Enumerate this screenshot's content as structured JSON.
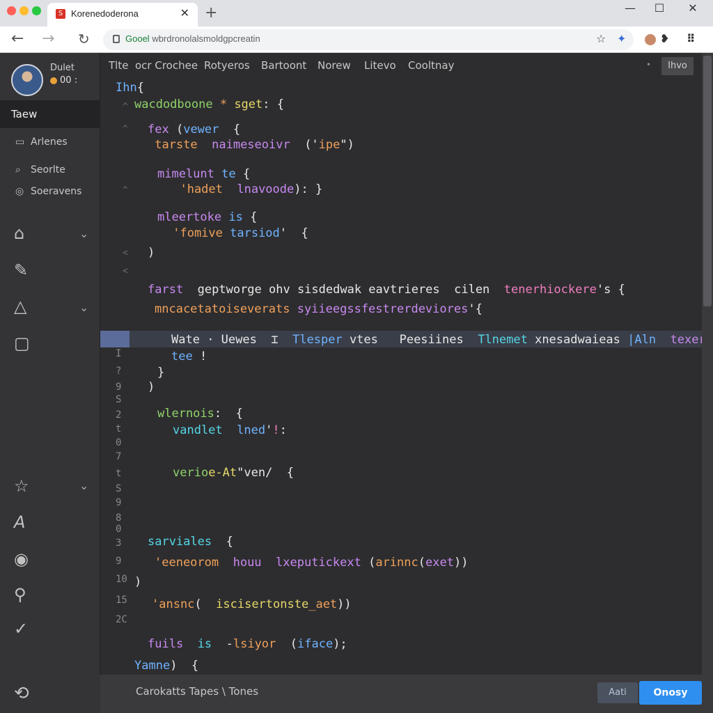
{
  "browser": {
    "tab_title": "Korenedoderona",
    "tab_close": "✕",
    "new_tab": "+",
    "url_scheme": "Gooel",
    "url_rest": " wbrdronolalsmoldgpcreatin",
    "window_controls": [
      "—",
      "☐",
      "✕"
    ]
  },
  "user": {
    "name": "Dulet",
    "status": "00",
    "status_suffix": ":"
  },
  "sidebar": {
    "active_label": "Taew",
    "items": [
      {
        "icon": "folder-icon",
        "glyph": "▭",
        "label": "Arlenes"
      },
      {
        "icon": "tag-icon",
        "glyph": "⌕",
        "label": "Seorlte"
      },
      {
        "icon": "settings-icon",
        "glyph": "◎",
        "label": "Soeravens"
      }
    ],
    "icons": [
      {
        "name": "home-icon",
        "glyph": "⌂",
        "chevron": true
      },
      {
        "name": "pen-icon",
        "glyph": "✎",
        "chevron": false
      },
      {
        "name": "triangle-icon",
        "glyph": "△",
        "chevron": true
      },
      {
        "name": "square-icon",
        "glyph": "▢",
        "chevron": false
      },
      {
        "name": "star-icon",
        "glyph": "☆",
        "chevron": true
      },
      {
        "name": "script-icon",
        "glyph": "A",
        "chevron": false
      },
      {
        "name": "record-icon",
        "glyph": "◉",
        "chevron": false
      },
      {
        "name": "search-icon",
        "glyph": "⚲",
        "chevron": false
      },
      {
        "name": "check-icon",
        "glyph": "✓",
        "chevron": false
      }
    ],
    "bottom_icon": "⟲"
  },
  "menubar": {
    "items": [
      "Tlte",
      "ocr Crochee",
      "Rotyeros",
      "Bartoont",
      "Norew",
      "Litevo",
      "Cooltnay"
    ],
    "dot": "•",
    "button": "Ihvo"
  },
  "code_lines": [
    [
      {
        "t": "Ihn",
        "c": "c-blue"
      },
      {
        "t": "{",
        "c": "c-white"
      }
    ],
    [
      {
        "t": "wacdodboone",
        "c": "c-green"
      },
      {
        "t": " * ",
        "c": "c-orange"
      },
      {
        "t": "sget",
        "c": "c-yellow"
      },
      {
        "t": ": {",
        "c": "c-white"
      }
    ],
    [
      {
        "t": "fex",
        "c": "c-purple"
      },
      {
        "t": " (",
        "c": "c-white"
      },
      {
        "t": "vewer",
        "c": "c-blue"
      },
      {
        "t": "  {",
        "c": "c-white"
      }
    ],
    [
      {
        "t": " tarste",
        "c": "c-orange"
      },
      {
        "t": "  naimeseoivr",
        "c": "c-purple"
      },
      {
        "t": "  ('",
        "c": "c-white"
      },
      {
        "t": "ipe",
        "c": "c-orange"
      },
      {
        "t": "\")",
        "c": "c-white"
      }
    ],
    [
      {
        "t": "mimelunt",
        "c": "c-purple"
      },
      {
        "t": " te",
        "c": "c-blue"
      },
      {
        "t": " {",
        "c": "c-white"
      }
    ],
    [
      {
        "t": "  'hadet",
        "c": "c-orange"
      },
      {
        "t": "  lnavoode",
        "c": "c-purple"
      },
      {
        "t": "): }",
        "c": "c-white"
      }
    ],
    [
      {
        "t": "mleertoke",
        "c": "c-purple"
      },
      {
        "t": " is",
        "c": "c-blue"
      },
      {
        "t": " {",
        "c": "c-white"
      }
    ],
    [
      {
        "t": " 'fomive",
        "c": "c-orange"
      },
      {
        "t": " tarsiod",
        "c": "c-blue"
      },
      {
        "t": "'  {",
        "c": "c-white"
      }
    ],
    [
      {
        "t": ")",
        "c": "c-white"
      }
    ],
    [
      {
        "t": "farst",
        "c": "c-purple"
      },
      {
        "t": "  geptworge ohv sisdedwak eavtrieres  cilen  ",
        "c": "c-white"
      },
      {
        "t": "tenerhiockere",
        "c": "c-pink"
      },
      {
        "t": "'s {",
        "c": "c-white"
      }
    ],
    [
      {
        "t": "mncacetatoiseverats",
        "c": "c-orange"
      },
      {
        "t": " syiieegssfestrerdeviores",
        "c": "c-purple"
      },
      {
        "t": "'{",
        "c": "c-white"
      }
    ],
    [
      {
        "t": "Wate",
        "c": "c-white"
      },
      {
        "t": " · ",
        "c": "c-white"
      },
      {
        "t": "Uewes",
        "c": "c-white"
      },
      {
        "t": "  ⌶  ",
        "c": "c-white"
      },
      {
        "t": "Tlesper",
        "c": "c-blue"
      },
      {
        "t": " vtes   ",
        "c": "c-white"
      },
      {
        "t": "Peesiines",
        "c": "c-white"
      },
      {
        "t": "  Tlnemet",
        "c": "c-cyan"
      },
      {
        "t": " xnesadwaieas",
        "c": "c-white"
      },
      {
        "t": " |Aln",
        "c": "c-blue"
      },
      {
        "t": "  texer",
        "c": "c-purple"
      },
      {
        "t": "(",
        "c": "c-white"
      }
    ],
    [
      {
        "t": "tee",
        "c": "c-blue"
      },
      {
        "t": " !",
        "c": "c-white"
      }
    ],
    [
      {
        "t": "}",
        "c": "c-white"
      }
    ],
    [
      {
        "t": ")",
        "c": "c-white"
      }
    ],
    [
      {
        "t": "wlernois",
        "c": "c-green"
      },
      {
        "t": ":  {",
        "c": "c-white"
      }
    ],
    [
      {
        "t": "vandlet",
        "c": "c-cyan"
      },
      {
        "t": "  lned",
        "c": "c-blue"
      },
      {
        "t": "'",
        "c": "c-white"
      },
      {
        "t": "!",
        "c": "c-pink"
      },
      {
        "t": ":",
        "c": "c-white"
      }
    ],
    [
      {
        "t": "verio",
        "c": "c-green"
      },
      {
        "t": "e-At",
        "c": "c-yellow"
      },
      {
        "t": "\"ven/",
        "c": "c-white"
      },
      {
        "t": "  {",
        "c": "c-white"
      }
    ],
    [
      {
        "t": "sarviales",
        "c": "c-cyan"
      },
      {
        "t": "  {",
        "c": "c-white"
      }
    ],
    [
      {
        "t": "'eeneorom",
        "c": "c-orange"
      },
      {
        "t": "  houu",
        "c": "c-purple"
      },
      {
        "t": "  lxeputickext",
        "c": "c-purple"
      },
      {
        "t": " (",
        "c": "c-white"
      },
      {
        "t": "arinnc",
        "c": "c-orange"
      },
      {
        "t": "(",
        "c": "c-white"
      },
      {
        "t": "exet",
        "c": "c-purple"
      },
      {
        "t": "))",
        "c": "c-white"
      }
    ],
    [
      {
        "t": ")",
        "c": "c-white"
      }
    ],
    [
      {
        "t": "'ansnc",
        "c": "c-orange"
      },
      {
        "t": "(  ",
        "c": "c-white"
      },
      {
        "t": "isciser",
        "c": "c-yellow"
      },
      {
        "t": "tonste",
        "c": "c-yellow"
      },
      {
        "t": "_aet",
        "c": "c-orange"
      },
      {
        "t": "))",
        "c": "c-white"
      }
    ],
    [
      {
        "t": "fuils",
        "c": "c-purple"
      },
      {
        "t": "  is",
        "c": "c-cyan"
      },
      {
        "t": "  -",
        "c": "c-white"
      },
      {
        "t": "lsiyor",
        "c": "c-orange"
      },
      {
        "t": "  (",
        "c": "c-white"
      },
      {
        "t": "iface",
        "c": "c-blue"
      },
      {
        "t": ");",
        "c": "c-white"
      }
    ],
    [
      {
        "t": "Yamne",
        "c": "c-blue"
      },
      {
        "t": ")  {",
        "c": "c-white"
      }
    ]
  ],
  "line_numbers": [
    "I",
    "?",
    "9",
    "S",
    "2",
    "t",
    "0",
    "7",
    "t",
    "S",
    "9",
    "8",
    "0",
    "3",
    "9",
    "10",
    "15",
    "2C"
  ],
  "gutter_marks": [
    "^",
    "^",
    "^",
    "<",
    "<"
  ],
  "status": {
    "text": "Carokatts  Tapes  \\  Tones",
    "secondary_button": "Aati",
    "primary_button": "Onosy"
  },
  "colors": {
    "accent": "#2f8ff0",
    "editor_bg": "#2d2d2f",
    "sidebar_bg": "#343437",
    "highlight_row": "#3a3e48"
  }
}
